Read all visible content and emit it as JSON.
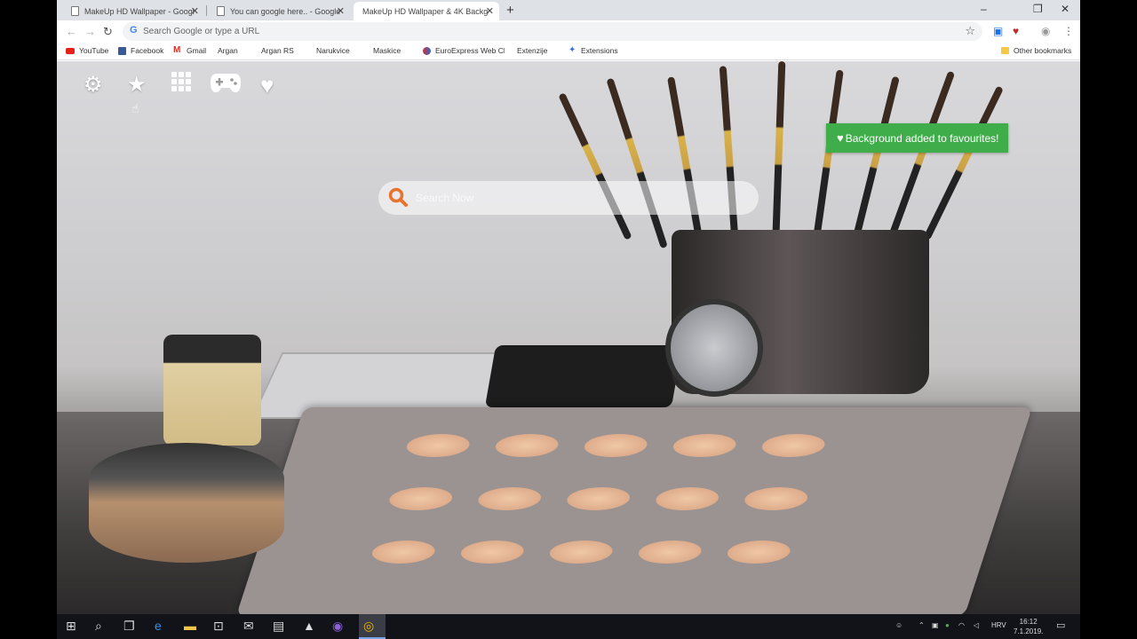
{
  "browser": {
    "tabs": [
      {
        "title": "MakeUp HD Wallpaper - Googl",
        "active": false
      },
      {
        "title": "You can google here.. - Google",
        "active": false
      },
      {
        "title": "MakeUp HD Wallpaper & 4K Backgro",
        "active": true
      }
    ],
    "new_tab": "+",
    "window_controls": {
      "minimize": "–",
      "maximize": "❐",
      "close": "✕"
    },
    "address_bar": {
      "placeholder": "Search Google or type a URL",
      "g_logo": "G"
    },
    "bookmarks": [
      {
        "label": "YouTube",
        "icon": "youtube-icon"
      },
      {
        "label": "Facebook",
        "icon": "facebook-icon"
      },
      {
        "label": "Gmail",
        "icon": "gmail-icon"
      },
      {
        "label": "Argan",
        "icon": "page-icon"
      },
      {
        "label": "Argan RS",
        "icon": "page-icon"
      },
      {
        "label": "Narukvice",
        "icon": "page-icon"
      },
      {
        "label": "Maskice",
        "icon": "page-icon"
      },
      {
        "label": "EuroExpress Web Cli",
        "icon": "euroexpress-icon"
      },
      {
        "label": "Extenzije",
        "icon": "page-icon"
      },
      {
        "label": "Extensions",
        "icon": "extension-icon"
      }
    ],
    "other_bookmarks": "Other bookmarks"
  },
  "page": {
    "toolbar_icons": [
      "gear-icon",
      "star-icon",
      "apps-grid-icon",
      "gamepad-icon",
      "heart-icon"
    ],
    "search": {
      "placeholder": "Search Now"
    },
    "toast": "Background added to favourites!"
  },
  "taskbar": {
    "language": "HRV",
    "time": "16:12",
    "date": "7.1.2019."
  }
}
